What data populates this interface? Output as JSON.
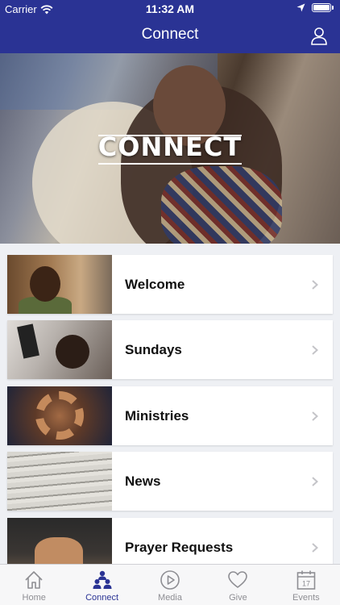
{
  "status_bar": {
    "carrier": "Carrier",
    "time": "11:32 AM"
  },
  "nav": {
    "title": "Connect",
    "profile_icon": "person-icon"
  },
  "hero": {
    "title": "CONNECT"
  },
  "items": [
    {
      "label": "Welcome",
      "icon": "chevron-right-icon"
    },
    {
      "label": "Sundays",
      "icon": "chevron-right-icon"
    },
    {
      "label": "Ministries",
      "icon": "chevron-right-icon"
    },
    {
      "label": "News",
      "icon": "chevron-right-icon"
    },
    {
      "label": "Prayer Requests",
      "icon": "chevron-right-icon"
    }
  ],
  "tabs": [
    {
      "label": "Home",
      "icon": "home-icon",
      "active": false
    },
    {
      "label": "Connect",
      "icon": "people-icon",
      "active": true
    },
    {
      "label": "Media",
      "icon": "play-icon",
      "active": false
    },
    {
      "label": "Give",
      "icon": "heart-icon",
      "active": false
    },
    {
      "label": "Events",
      "icon": "calendar-icon",
      "active": false,
      "badge_text": "17"
    }
  ],
  "colors": {
    "accent": "#2a3394",
    "tab_inactive": "#8e8e93",
    "background": "#eef0f4"
  }
}
